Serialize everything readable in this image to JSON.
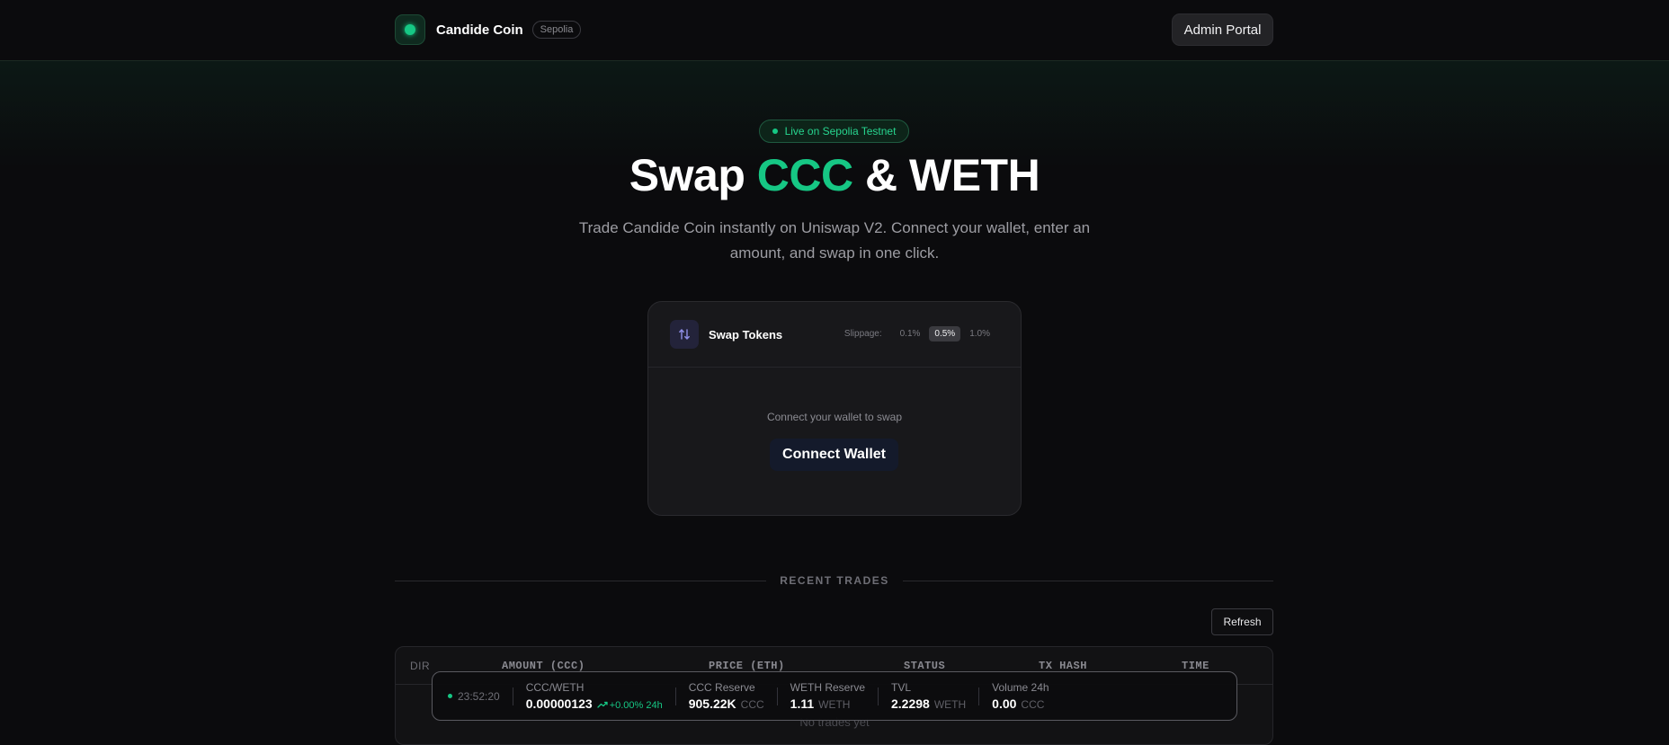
{
  "header": {
    "brand_name": "Candide Coin",
    "network_badge": "Sepolia",
    "admin_button": "Admin Portal"
  },
  "hero": {
    "live_pill": "Live on Sepolia Testnet",
    "title_prefix": "Swap ",
    "title_accent": "CCC",
    "title_suffix": " & WETH",
    "subtitle": "Trade Candide Coin instantly on Uniswap V2. Connect your wallet, enter an amount, and swap in one click."
  },
  "swap_card": {
    "title": "Swap Tokens",
    "slippage_label": "Slippage:",
    "slippage_options": [
      "0.1%",
      "0.5%",
      "1.0%"
    ],
    "slippage_selected": "0.5%",
    "connect_hint": "Connect your wallet to swap",
    "connect_button": "Connect Wallet"
  },
  "recent_trades": {
    "title": "RECENT TRADES",
    "refresh_button": "Refresh",
    "columns": [
      "DIR",
      "AMOUNT (CCC)",
      "PRICE (ETH)",
      "STATUS",
      "TX HASH",
      "TIME"
    ],
    "empty_text": "No trades yet"
  },
  "ticker": {
    "time": "23:52:20",
    "pair_label": "CCC/WETH",
    "pair_price": "0.00000123",
    "pair_change": "+0.00% 24h",
    "ccc_reserve_label": "CCC Reserve",
    "ccc_reserve_value": "905.22K",
    "ccc_reserve_unit": "CCC",
    "weth_reserve_label": "WETH Reserve",
    "weth_reserve_value": "1.11",
    "weth_reserve_unit": "WETH",
    "tvl_label": "TVL",
    "tvl_value": "2.2298",
    "tvl_unit": "WETH",
    "volume_label": "Volume 24h",
    "volume_value": "0.00",
    "volume_unit": "CCC"
  },
  "colors": {
    "accent": "#16c784",
    "background": "#0b0b0d",
    "card": "#18181b"
  }
}
